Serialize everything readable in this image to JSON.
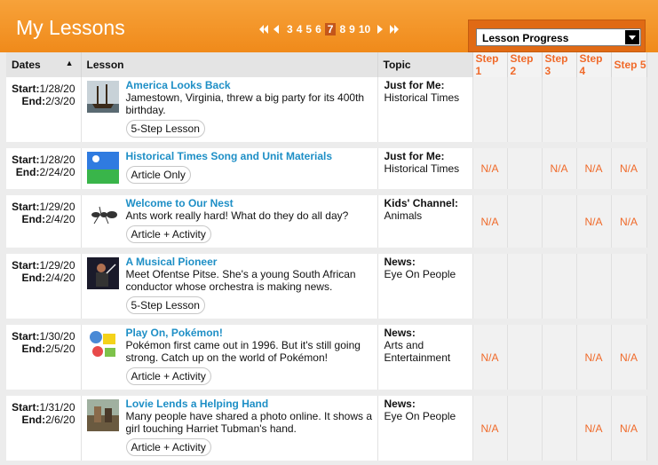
{
  "header": {
    "title": "My Lessons",
    "pages": [
      "3",
      "4",
      "5",
      "6",
      "7",
      "8",
      "9",
      "10"
    ],
    "current_page": "7",
    "progress_select": "Lesson Progress"
  },
  "columns": {
    "dates": "Dates",
    "lesson": "Lesson",
    "topic": "Topic",
    "steps": [
      "Step 1",
      "Step 2",
      "Step 3",
      "Step 4",
      "Step 5"
    ]
  },
  "rows": [
    {
      "start": "1/28/20",
      "end": "2/3/20",
      "title": "America Looks Back",
      "desc": "Jamestown, Virginia, threw a big party for its 400th birthday.",
      "type": "5-Step Lesson",
      "topic_head": "Just for Me:",
      "topic": "Historical Times",
      "steps": [
        "",
        "",
        "",
        "",
        ""
      ]
    },
    {
      "start": "1/28/20",
      "end": "2/24/20",
      "title": "Historical Times Song and Unit Materials",
      "desc": "",
      "type": "Article Only",
      "topic_head": "Just for Me:",
      "topic": "Historical Times",
      "steps": [
        "N/A",
        "",
        "N/A",
        "N/A",
        "N/A"
      ]
    },
    {
      "start": "1/29/20",
      "end": "2/4/20",
      "title": "Welcome to Our Nest",
      "desc": "Ants work really hard! What do they do all day?",
      "type": "Article + Activity",
      "topic_head": "Kids' Channel:",
      "topic": "Animals",
      "steps": [
        "N/A",
        "",
        "",
        "N/A",
        "N/A"
      ]
    },
    {
      "start": "1/29/20",
      "end": "2/4/20",
      "title": "A Musical Pioneer",
      "desc": "Meet Ofentse Pitse. She's a young South African conductor whose orchestra is making news.",
      "type": "5-Step Lesson",
      "topic_head": "News:",
      "topic": "Eye On People",
      "steps": [
        "",
        "",
        "",
        "",
        ""
      ]
    },
    {
      "start": "1/30/20",
      "end": "2/5/20",
      "title": "Play On, Pokémon!",
      "desc": "Pokémon first came out in 1996. But it's still going strong. Catch up on the world of Pokémon!",
      "type": "Article + Activity",
      "topic_head": "News:",
      "topic": "Arts and Entertainment",
      "steps": [
        "N/A",
        "",
        "",
        "N/A",
        "N/A"
      ]
    },
    {
      "start": "1/31/20",
      "end": "2/6/20",
      "title": "Lovie Lends a Helping Hand",
      "desc": "Many people have shared a photo online. It shows a girl touching Harriet Tubman's hand.",
      "type": "Article + Activity",
      "topic_head": "News:",
      "topic": "Eye On People",
      "steps": [
        "N/A",
        "",
        "",
        "N/A",
        "N/A"
      ]
    }
  ],
  "labels": {
    "start": "Start:",
    "end": "End:"
  },
  "thumbs": [
    "ship-photo",
    "landscape-photo",
    "ant-photo",
    "conductor-photo",
    "pokemon-photo",
    "painting-photo"
  ]
}
